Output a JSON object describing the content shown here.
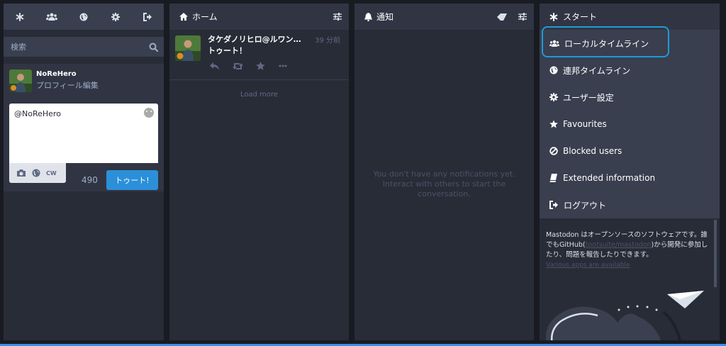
{
  "nav": {
    "icons": [
      "asterisk-icon",
      "users-icon",
      "globe-icon",
      "gear-icon",
      "sign-out-icon"
    ]
  },
  "search": {
    "placeholder": "検索"
  },
  "account": {
    "username": "NoReHero",
    "edit_profile": "プロフィール編集"
  },
  "compose": {
    "value": "@NoReHero",
    "cw_label": "CW",
    "char_count": "490",
    "toot_button": "トゥート!"
  },
  "home": {
    "title": "ホーム",
    "status": {
      "display_name": "タケダノリヒロ@ルワンダ...",
      "time": "39 分前",
      "content": "トゥート！"
    },
    "load_more": "Load more"
  },
  "notifications": {
    "title": "通知",
    "empty_text": "You don't have any notifications yet. Interact with others to start the conversation."
  },
  "getting_started": {
    "title": "スタート",
    "items": [
      {
        "label": "ローカルタイムライン",
        "icon": "users-icon"
      },
      {
        "label": "連邦タイムライン",
        "icon": "globe-icon"
      },
      {
        "label": "ユーザー設定",
        "icon": "gear-icon"
      },
      {
        "label": "Favourites",
        "icon": "star-icon"
      },
      {
        "label": "Blocked users",
        "icon": "ban-icon"
      },
      {
        "label": "Extended information",
        "icon": "book-icon"
      },
      {
        "label": "ログアウト",
        "icon": "sign-out-icon"
      }
    ],
    "about_pre": "Mastodon はオープンソースのソフトウェアです。誰でもGitHub(",
    "about_link": "tootsuite/mastodon",
    "about_post": ")から開発に参加したり、問題を報告したりできます。",
    "apps_link": "Various apps are available"
  },
  "colors": {
    "accent": "#2b90d9",
    "highlight": "#1e9bd8",
    "background": "#191b22"
  }
}
